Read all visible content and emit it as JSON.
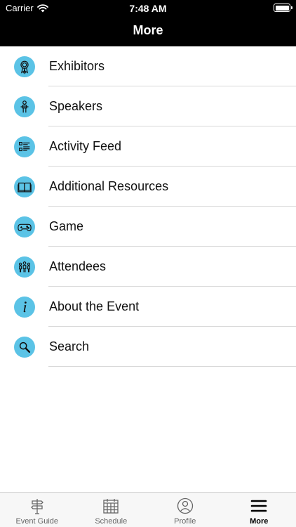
{
  "status_bar": {
    "carrier": "Carrier",
    "time": "7:48 AM"
  },
  "header": {
    "title": "More"
  },
  "menu": {
    "items": [
      {
        "label": "Exhibitors",
        "icon": "ribbon-award-icon"
      },
      {
        "label": "Speakers",
        "icon": "speaker-person-icon"
      },
      {
        "label": "Activity Feed",
        "icon": "list-feed-icon"
      },
      {
        "label": "Additional Resources",
        "icon": "book-icon"
      },
      {
        "label": "Game",
        "icon": "gamepad-icon"
      },
      {
        "label": "Attendees",
        "icon": "people-group-icon"
      },
      {
        "label": "About the Event",
        "icon": "info-icon"
      },
      {
        "label": "Search",
        "icon": "search-icon"
      }
    ]
  },
  "tabbar": {
    "tabs": [
      {
        "label": "Event Guide",
        "icon": "signpost-icon",
        "active": false
      },
      {
        "label": "Schedule",
        "icon": "calendar-icon",
        "active": false
      },
      {
        "label": "Profile",
        "icon": "profile-icon",
        "active": false
      },
      {
        "label": "More",
        "icon": "hamburger-menu-icon",
        "active": true
      }
    ]
  },
  "colors": {
    "accent": "#5bc3e6",
    "header_bg": "#000000",
    "divider": "#d8d8d8"
  }
}
